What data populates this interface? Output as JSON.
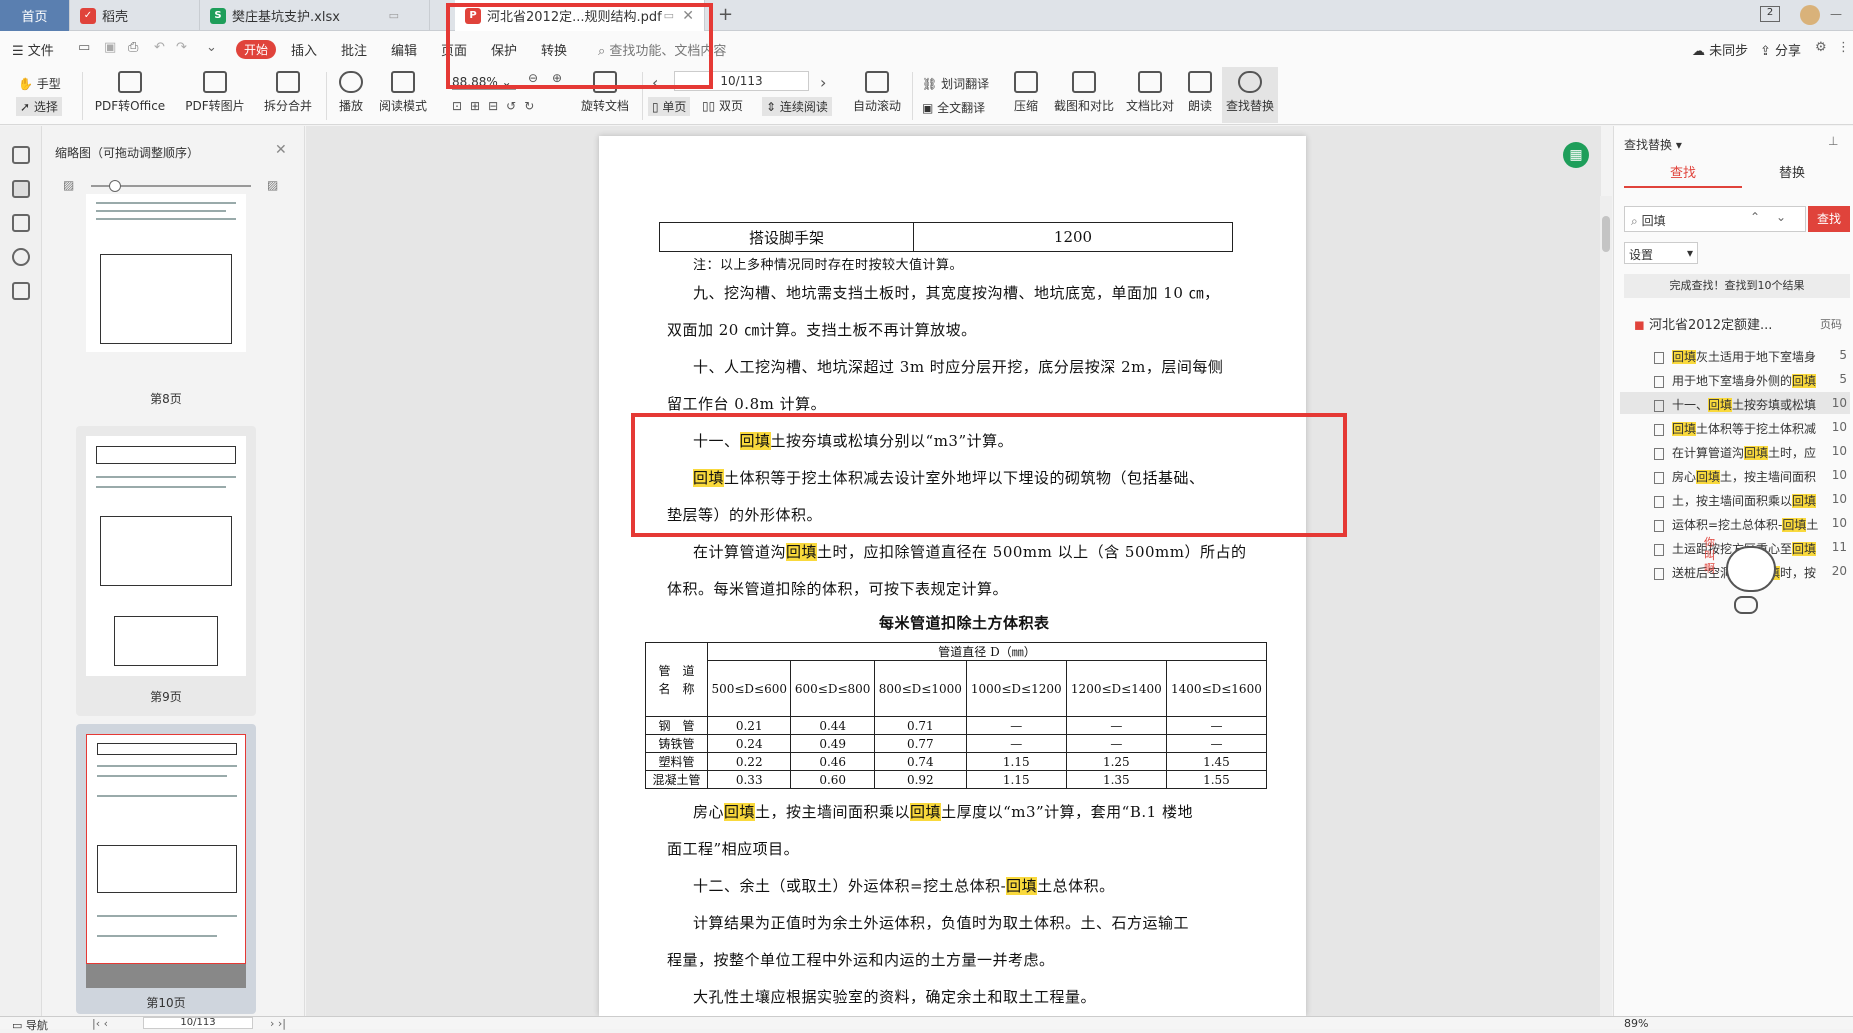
{
  "tabs": {
    "home": "首页",
    "t1": "稻壳",
    "t2": "樊庄基坑支护.xlsx",
    "t3": "河北省2012定...规则结构.pdf"
  },
  "menu": {
    "file": "文件",
    "start": "开始",
    "insert": "插入",
    "annotate": "批注",
    "edit": "编辑",
    "page": "页面",
    "protect": "保护",
    "convert": "转换",
    "search_placeholder": "查找功能、文档内容",
    "unsynced": "未同步",
    "share": "分享"
  },
  "ribbon": {
    "hand": "手型",
    "select": "选择",
    "pdf_office": "PDF转Office",
    "pdf_img": "PDF转图片",
    "split": "拆分合并",
    "play": "播放",
    "read_mode": "阅读模式",
    "zoom": "88.88%",
    "rotate": "旋转文档",
    "page_num": "10/113",
    "single": "单页",
    "double": "双页",
    "continuous": "连续阅读",
    "autoscroll": "自动滚动",
    "word_translate": "划词翻译",
    "full_translate": "全文翻译",
    "compress": "压缩",
    "screenshot": "截图和对比",
    "compare": "文档比对",
    "read_aloud": "朗读",
    "find_replace": "查找替换"
  },
  "thumbs": {
    "title": "缩略图（可拖动调整顺序）",
    "p8": "第8页",
    "p9": "第9页",
    "p10": "第10页"
  },
  "doc": {
    "row_label": "搭设脚手架",
    "row_value": "1200",
    "note": "注：以上多种情况同时存在时按较大值计算。",
    "l1": "九、挖沟槽、地坑需支挡土板时，其宽度按沟槽、地坑底宽，单面加 10 ㎝，",
    "l2": "双面加 20 ㎝计算。支挡土板不再计算放坡。",
    "l3": "十、人工挖沟槽、地坑深超过 3m 时应分层开挖，底分层按深 2m，层间每侧",
    "l4": "留工作台 0.8m 计算。",
    "l5a": "十一、",
    "hw": "回填",
    "l5b": "土按夯填或松填分别以“m3”计算。",
    "l6b": "土体积等于挖土体积减去设计室外地坪以下埋设的砌筑物（包括基础、",
    "l7": "垫层等）的外形体积。",
    "l8a": "在计算管道沟",
    "l8b": "土时，应扣除管道直径在 500mm 以上（含 500mm）所占的",
    "l9": "体积。每米管道扣除的体积，可按下表规定计算。",
    "table_title": "每米管道扣除土方体积表",
    "l10a": "房心",
    "l10b": "土，按主墙间面积乘以",
    "l10c": "土厚度以“m3”计算，套用“B.1 楼地",
    "l11": "面工程”相应项目。",
    "l12a": "十二、余土（或取土）外运体积=挖土总体积-",
    "l12b": "土总体积。",
    "l13": "计算结果为正值时为余土外运体积，负值时为取土体积。土、石方运输工",
    "l14": "程量，按整个单位工程中外运和内运的土方量一并考虑。",
    "l15": "大孔性土壤应根据实验室的资料，确定余土和取土工程量。"
  },
  "pipe_table": {
    "corner": "管　道\n名　称",
    "header": "管道直径 D（㎜）",
    "cols": [
      "500≤D≤600",
      "600≤D≤800",
      "800≤D≤1000",
      "1000≤D≤1200",
      "1200≤D≤1400",
      "1400≤D≤1600"
    ],
    "rows": [
      {
        "name": "钢　管",
        "vals": [
          "0.21",
          "0.44",
          "0.71",
          "—",
          "—",
          "—"
        ]
      },
      {
        "name": "铸铁管",
        "vals": [
          "0.24",
          "0.49",
          "0.77",
          "—",
          "—",
          "—"
        ]
      },
      {
        "name": "塑料管",
        "vals": [
          "0.22",
          "0.46",
          "0.74",
          "1.15",
          "1.25",
          "1.45"
        ]
      },
      {
        "name": "混凝土管",
        "vals": [
          "0.33",
          "0.60",
          "0.92",
          "1.15",
          "1.35",
          "1.55"
        ]
      }
    ]
  },
  "right": {
    "title": "查找替换",
    "tab_find": "查找",
    "tab_replace": "替换",
    "query": "回填",
    "find_btn": "查找",
    "settings": "设置",
    "status": "完成查找！查找到10个结果",
    "doc_name": "河北省2012定额建...",
    "page_col": "页码",
    "results": [
      {
        "pre": "",
        "hl": "回填",
        "post": "灰土适用于地下室墙身",
        "page": "5"
      },
      {
        "pre": "用于地下室墙身外侧的",
        "hl": "回填",
        "post": "",
        "page": "5"
      },
      {
        "pre": "十一、",
        "hl": "回填",
        "post": "土按夯填或松填",
        "page": "10"
      },
      {
        "pre": "",
        "hl": "回填",
        "post": "土体积等于挖土体积减",
        "page": "10"
      },
      {
        "pre": "在计算管道沟",
        "hl": "回填",
        "post": "土时，应",
        "page": "10"
      },
      {
        "pre": "房心",
        "hl": "回填",
        "post": "土，按主墙间面积",
        "page": "10"
      },
      {
        "pre": "土，按主墙间面积乘以",
        "hl": "回填",
        "post": "",
        "page": "10"
      },
      {
        "pre": "运体积=挖土总体积-",
        "hl": "回填",
        "post": "土",
        "page": "10"
      },
      {
        "pre": "土运距按挖方区重心至",
        "hl": "回填",
        "post": "",
        "page": "11"
      },
      {
        "pre": "送桩后空洞如需",
        "hl": "回填",
        "post": "时，按",
        "page": "20"
      }
    ]
  },
  "status": {
    "nav": "导航",
    "page": "10/113",
    "zoom": "89%"
  }
}
